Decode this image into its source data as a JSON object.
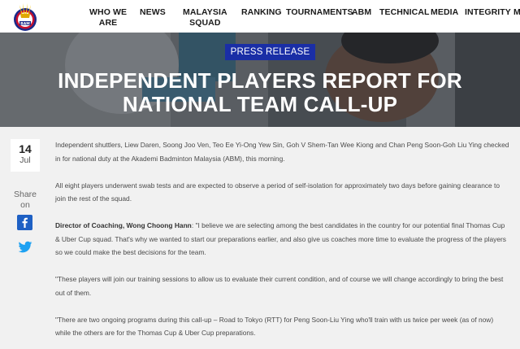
{
  "header": {
    "logo_label": "BAM",
    "nav": [
      {
        "label": "WHO WE\nARE"
      },
      {
        "label": "NEWS"
      },
      {
        "label": "MALAYSIA\nSQUAD"
      },
      {
        "label": "RANKING"
      },
      {
        "label": "TOURNAMENTS"
      },
      {
        "label": "ABM"
      },
      {
        "label": "TECHNICAL"
      },
      {
        "label": "MEDIA"
      },
      {
        "label": "INTEGRITY"
      },
      {
        "label": "M"
      }
    ]
  },
  "hero": {
    "badge": "PRESS RELEASE",
    "title": "INDEPENDENT PLAYERS REPORT FOR NATIONAL TEAM CALL-UP"
  },
  "date": {
    "day": "14",
    "month": "Jul"
  },
  "share": {
    "label": "Share\non",
    "icons": [
      "facebook-icon",
      "twitter-icon"
    ]
  },
  "colors": {
    "badge": "#1a2ea6",
    "facebook": "#1e60c4",
    "twitter": "#1da1f2"
  },
  "article": {
    "p1": "Independent shuttlers, Liew Daren, Soong Joo Ven, Teo Ee Yi-Ong Yew Sin, Goh V Shem-Tan Wee Kiong and Chan Peng Soon-Goh Liu Ying checked in for national duty at the Akademi Badminton Malaysia (ABM), this morning.",
    "p2": "All eight players underwent swab tests and are expected to observe a period of self-isolation for approximately two days before gaining clearance to join the rest of the squad.",
    "p3_speaker": "Director of Coaching, Wong Choong Hann",
    "p3_text": ": \"I believe we are selecting among the best candidates in the country for our potential final Thomas Cup & Uber Cup squad. That's why we wanted to start our preparations earlier, and also give us coaches more time to evaluate the progress of the players so we could make the best decisions for the team.",
    "p4": "\"These players will join our training sessions to allow us to evaluate their current condition, and of course we will change accordingly to bring the best out of them.",
    "p5": "\"There are two ongoing programs during this call-up – Road to Tokyo (RTT) for Peng Soon-Liu Ying who'll train with us twice per week (as of now) while the others are for the Thomas Cup & Uber Cup preparations."
  }
}
